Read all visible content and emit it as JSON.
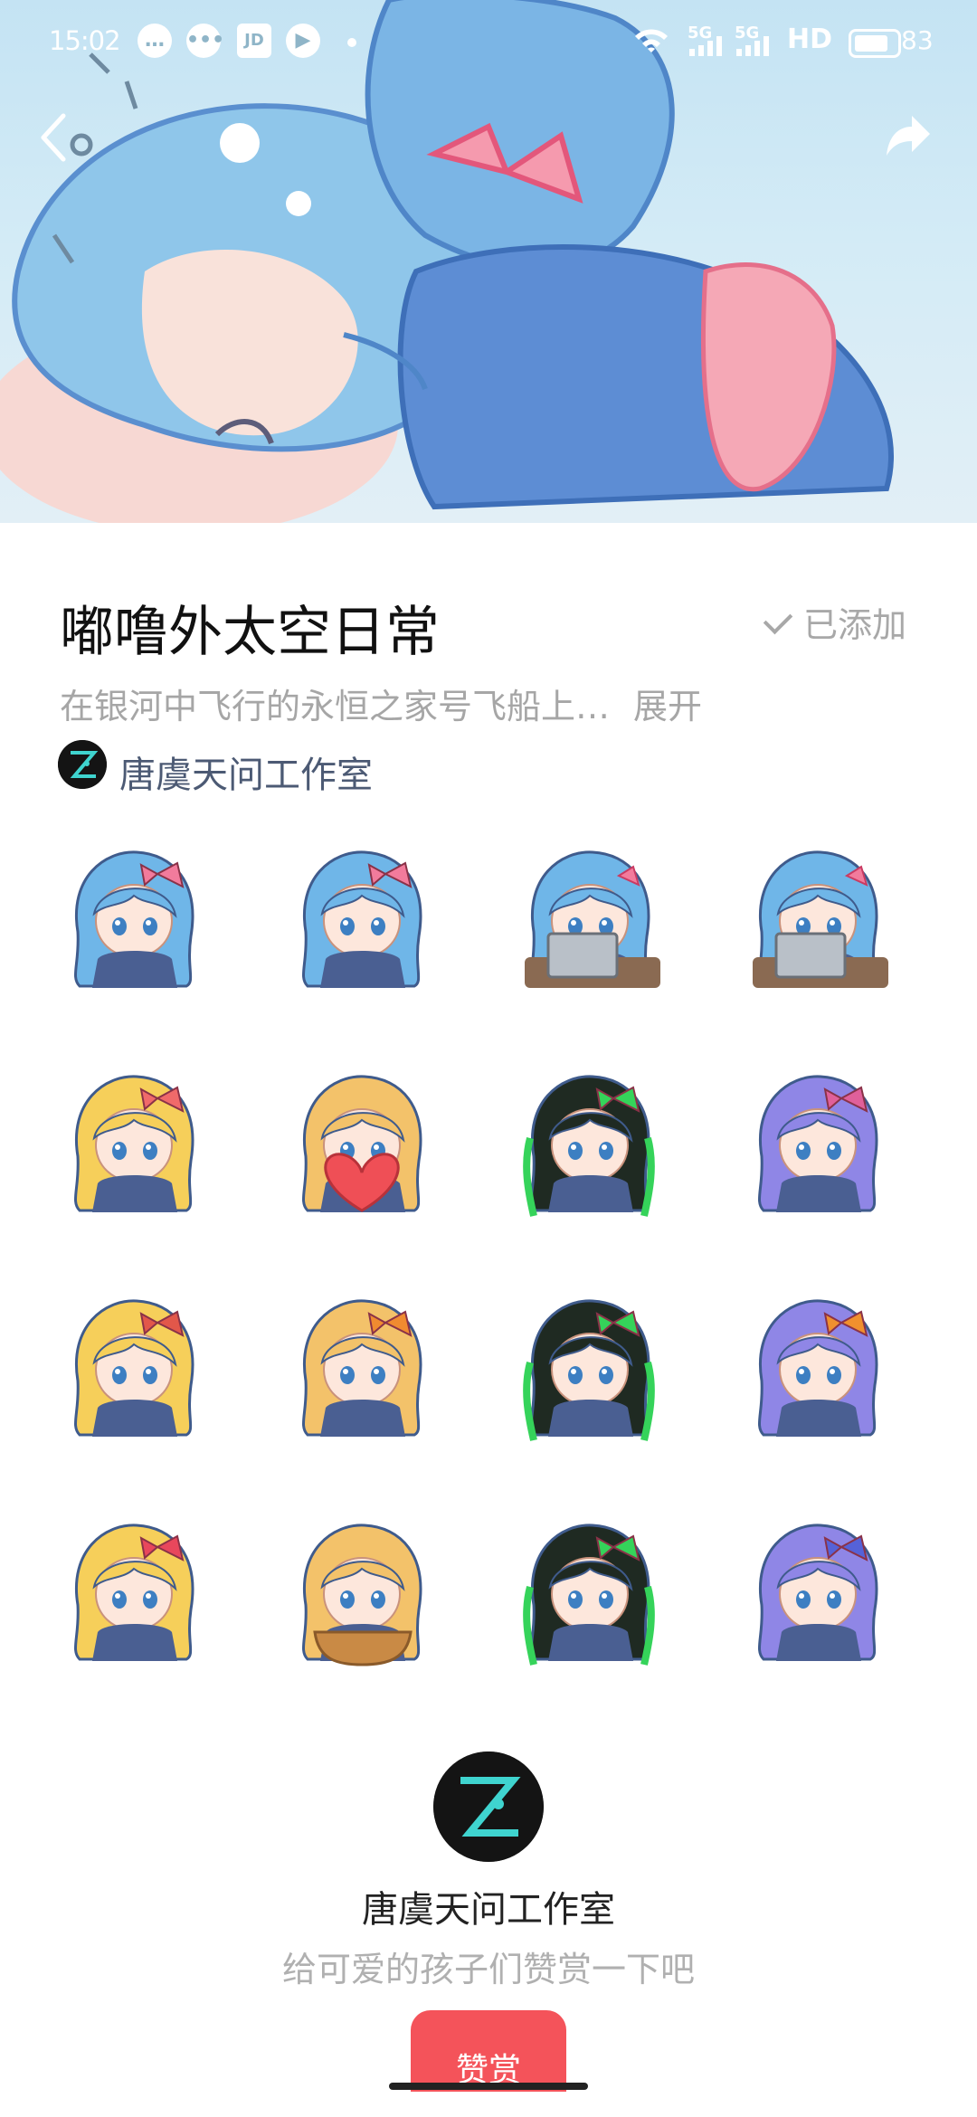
{
  "status_bar": {
    "time": "15:02",
    "net_label": "5G",
    "hd_label": "HD",
    "battery": "83"
  },
  "header": {
    "back_icon": "chevron-left-icon",
    "share_icon": "share-arrow-icon"
  },
  "pack": {
    "title": "嘟噜外太空日常",
    "added_label": "已添加",
    "description": "在银河中飞行的永恒之家号飞船上…",
    "expand_label": "展开",
    "author": "唐虞天问工作室"
  },
  "stickers": [
    {
      "character": "blue-hair-girl",
      "hair": "#6fb6e8",
      "accent": "#f27b9c"
    },
    {
      "character": "blue-hair-girl",
      "hair": "#6fb6e8",
      "accent": "#f27b9c"
    },
    {
      "character": "blue-hair-girl-laptop",
      "hair": "#6fb6e8",
      "accent": "#f27b9c"
    },
    {
      "character": "blue-hair-girl-laptop",
      "hair": "#6fb6e8",
      "accent": "#f27b9c"
    },
    {
      "character": "blonde-girl",
      "hair": "#f6cf5a",
      "accent": "#f06a6a"
    },
    {
      "character": "blonde-girl-heart",
      "hair": "#f3c26a",
      "accent": "#ef4f56"
    },
    {
      "character": "dark-green-girl",
      "hair": "#1f2a22",
      "accent": "#35d35a"
    },
    {
      "character": "purple-hair-girl",
      "hair": "#8f86e6",
      "accent": "#e0609a"
    },
    {
      "character": "blonde-girl",
      "hair": "#f6cf5a",
      "accent": "#e2574a"
    },
    {
      "character": "blonde-girl",
      "hair": "#f3c26a",
      "accent": "#f08b30"
    },
    {
      "character": "dark-green-girl",
      "hair": "#1f2a22",
      "accent": "#35d35a"
    },
    {
      "character": "purple-hair-girl",
      "hair": "#8f86e6",
      "accent": "#f0902e"
    },
    {
      "character": "blonde-girl",
      "hair": "#f6cf5a",
      "accent": "#e8475c"
    },
    {
      "character": "blonde-girl-bowl",
      "hair": "#f3c26a",
      "accent": "#c98a45"
    },
    {
      "character": "dark-green-girl",
      "hair": "#1f2a22",
      "accent": "#35d35a"
    },
    {
      "character": "purple-hair-girl",
      "hair": "#8f86e6",
      "accent": "#5562d8"
    }
  ],
  "author_card": {
    "name": "唐虞天问工作室",
    "tip_text": "给可爱的孩子们赞赏一下吧",
    "reward_label": "赞赏"
  },
  "colors": {
    "reward": "#f4535a",
    "author_link": "#4c5a74",
    "muted": "#a6a6a6"
  }
}
